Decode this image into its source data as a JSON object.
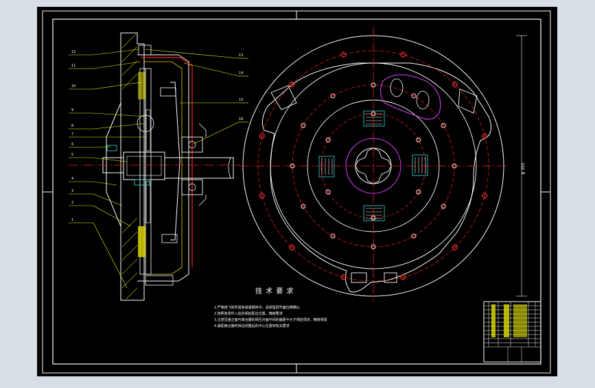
{
  "colors": {
    "background_outer": "#d8dee6",
    "canvas": "#000000",
    "line_white": "#ffffff",
    "centerline_red": "#ff2020",
    "leader_yellow": "#ffff00",
    "magenta": "#e040ff",
    "cyan": "#30e0e0",
    "hatch_yellow": "#e0e000"
  },
  "drawing": {
    "callouts_left": [
      "12",
      "11",
      "10",
      "9",
      "8",
      "7",
      "6",
      "5",
      "4",
      "3",
      "2",
      "1"
    ],
    "callouts_right": [
      "13",
      "14",
      "15",
      "16"
    ],
    "notes_title": "技 术 要 求",
    "notes": [
      "1.严格按飞轮所需各组装顺序中，具保留调节面位精确以",
      "2.按照各零件入处的相应配合位置，精度要求",
      "3.注意压盘正面与离合器的相互对面中间的面距不大于相应规定，精度保留",
      "4.装配离合器时保证调整后的中心位置到有关要求"
    ],
    "dimension_label": "φ 350"
  }
}
